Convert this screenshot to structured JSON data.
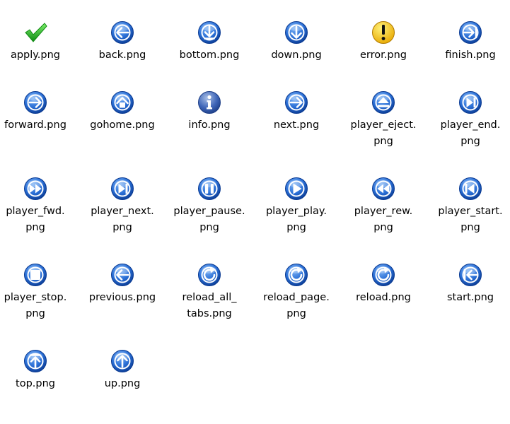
{
  "files": [
    {
      "icon": "apply-icon",
      "label": [
        "apply.png"
      ]
    },
    {
      "icon": "back-icon",
      "label": [
        "back.png"
      ]
    },
    {
      "icon": "bottom-icon",
      "label": [
        "bottom.png"
      ]
    },
    {
      "icon": "down-icon",
      "label": [
        "down.png"
      ]
    },
    {
      "icon": "error-icon",
      "label": [
        "error.png"
      ]
    },
    {
      "icon": "finish-icon",
      "label": [
        "finish.png"
      ]
    },
    {
      "icon": "forward-icon",
      "label": [
        "forward.png"
      ]
    },
    {
      "icon": "gohome-icon",
      "label": [
        "gohome.png"
      ]
    },
    {
      "icon": "info-icon",
      "label": [
        "info.png"
      ]
    },
    {
      "icon": "next-icon",
      "label": [
        "next.png"
      ]
    },
    {
      "icon": "player-eject-icon",
      "label": [
        "player_eject.",
        "png"
      ]
    },
    {
      "icon": "player-end-icon",
      "label": [
        "player_end.",
        "png"
      ]
    },
    {
      "icon": "player-fwd-icon",
      "label": [
        "player_fwd.",
        "png"
      ]
    },
    {
      "icon": "player-next-icon",
      "label": [
        "player_next.",
        "png"
      ]
    },
    {
      "icon": "player-pause-icon",
      "label": [
        "player_pause.",
        "png"
      ]
    },
    {
      "icon": "player-play-icon",
      "label": [
        "player_play.",
        "png"
      ]
    },
    {
      "icon": "player-rew-icon",
      "label": [
        "player_rew.",
        "png"
      ]
    },
    {
      "icon": "player-start-icon",
      "label": [
        "player_start.",
        "png"
      ]
    },
    {
      "icon": "player-stop-icon",
      "label": [
        "player_stop.",
        "png"
      ]
    },
    {
      "icon": "previous-icon",
      "label": [
        "previous.png"
      ]
    },
    {
      "icon": "reload-all-tabs-icon",
      "label": [
        "reload_all_",
        "tabs.png"
      ]
    },
    {
      "icon": "reload-page-icon",
      "label": [
        "reload_page.",
        "png"
      ]
    },
    {
      "icon": "reload-icon",
      "label": [
        "reload.png"
      ]
    },
    {
      "icon": "start-icon",
      "label": [
        "start.png"
      ]
    },
    {
      "icon": "top-icon",
      "label": [
        "top.png"
      ]
    },
    {
      "icon": "up-icon",
      "label": [
        "up.png"
      ]
    }
  ],
  "colors": {
    "blue_light": "#7fb4f5",
    "blue_mid": "#2a6fd6",
    "blue_dark": "#0a3a92",
    "yellow_light": "#fff27a",
    "yellow_dark": "#e8a800",
    "green_light": "#7cf06a",
    "green_dark": "#0e8a12"
  }
}
